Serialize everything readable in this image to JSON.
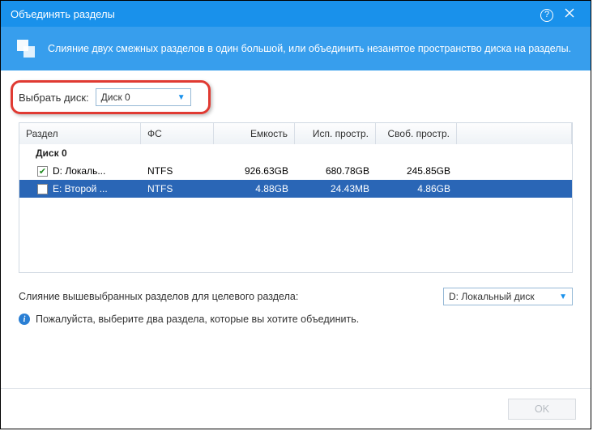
{
  "titlebar": {
    "title": "Объединять разделы"
  },
  "banner": {
    "text": "Слияние двух смежных разделов в один большой, или объединить незанятое пространство диска на разделы."
  },
  "selector": {
    "label": "Выбрать диск:",
    "value": "Диск 0"
  },
  "table": {
    "headers": {
      "partition": "Раздел",
      "fs": "ФС",
      "capacity": "Емкость",
      "used": "Исп. простр.",
      "free": "Своб. простр."
    },
    "group": "Диск 0",
    "rows": [
      {
        "checked": true,
        "selected": false,
        "partition": "D:  Локаль...",
        "fs": "NTFS",
        "capacity": "926.63GB",
        "used": "680.78GB",
        "free": "245.85GB"
      },
      {
        "checked": false,
        "selected": true,
        "partition": "E:  Второй ...",
        "fs": "NTFS",
        "capacity": "4.88GB",
        "used": "24.43MB",
        "free": "4.86GB"
      }
    ]
  },
  "target": {
    "label": "Слияние вышевыбранных разделов для целевого раздела:",
    "value": "D:  Локальный диск"
  },
  "hint": {
    "text": "Пожалуйста, выберите два раздела, которые вы хотите объединить."
  },
  "footer": {
    "ok": "OK"
  }
}
